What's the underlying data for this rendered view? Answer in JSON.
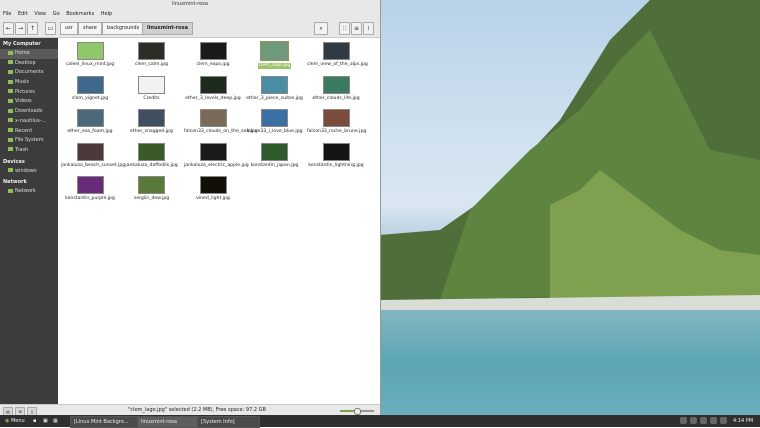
{
  "window": {
    "title": "linuxmint-rosa"
  },
  "menubar": [
    "File",
    "Edit",
    "View",
    "Go",
    "Bookmarks",
    "Help"
  ],
  "toolbar": {
    "back_icon": "back-arrow-icon",
    "forward_icon": "forward-arrow-icon",
    "up_icon": "up-arrow-icon",
    "breadcrumbs": [
      "usr",
      "share",
      "backgrounds",
      "linuxmint-rosa"
    ],
    "active_crumb": "linuxmint-rosa"
  },
  "sidebar": {
    "sections": [
      {
        "title": "My Computer",
        "items": [
          "Home",
          "Desktop",
          "Documents",
          "Music",
          "Pictures",
          "Videos",
          "Downloads",
          "x-nautilus-...",
          "Recent",
          "File System",
          "Trash"
        ]
      },
      {
        "title": "Devices",
        "items": [
          "windows"
        ]
      },
      {
        "title": "Network",
        "items": [
          "Network"
        ]
      }
    ]
  },
  "files": [
    {
      "name": "caleel_linux_mint.jpg",
      "color": "#8fc86a"
    },
    {
      "name": "clem_calm.jpg",
      "color": "#2a2e26"
    },
    {
      "name": "clem_expo.jpg",
      "color": "#1a1a1a"
    },
    {
      "name": "clem_lago.jpg",
      "color": "#6d9a78",
      "selected": true
    },
    {
      "name": "clem_view_of_the_alps.jpg",
      "color": "#2f3a44"
    },
    {
      "name": "clem_vignet.jpg",
      "color": "#3d6a8c"
    },
    {
      "name": "Credits",
      "color": "#f2f2f2"
    },
    {
      "name": "ether_3_levels_deep.jpg",
      "color": "#1c2b1c"
    },
    {
      "name": "ether_3_piece_suites.jpg",
      "color": "#4a8ea4"
    },
    {
      "name": "ether_clouds_life.jpg",
      "color": "#3b7a5e"
    },
    {
      "name": "ether_sea_foam.jpg",
      "color": "#4a6a7c"
    },
    {
      "name": "ether_snagged.jpg",
      "color": "#405060"
    },
    {
      "name": "falcon33_clouds_on_the_sea.jpg",
      "color": "#7a6a58"
    },
    {
      "name": "falcon33_i_love_blue.jpg",
      "color": "#3c6fa4"
    },
    {
      "name": "falcon33_roche_brune.jpg",
      "color": "#7a4c3c"
    },
    {
      "name": "jankaluza_beach_sunset.jpg",
      "color": "#4a3a3a"
    },
    {
      "name": "jankaluza_daffodils.jpg",
      "color": "#3a5a2a"
    },
    {
      "name": "jankaluza_electric_apple.jpg",
      "color": "#1a1a1a"
    },
    {
      "name": "konstantin_japan.jpg",
      "color": "#2f5a2a"
    },
    {
      "name": "konstantin_lightning.jpg",
      "color": "#151518"
    },
    {
      "name": "konstantin_purple.jpg",
      "color": "#6a2a7a"
    },
    {
      "name": "sergiin_dew.jpg",
      "color": "#5a7a3a"
    },
    {
      "name": "vined_light.jpg",
      "color": "#120e08"
    }
  ],
  "statusbar": {
    "text": "\"clem_lago.jpg\" selected (2.2 MB), Free space: 97.2 GB",
    "zoom_level": 0.5
  },
  "taskbar": {
    "menu_label": "Menu",
    "windows": [
      {
        "label": "[Linux Mint Backgro...",
        "active": false
      },
      {
        "label": "linuxmint-rosa",
        "active": true
      },
      {
        "label": "[System Info]",
        "active": false
      }
    ],
    "clock": "4:14 PM"
  },
  "accent_color": "#8fbf5a"
}
